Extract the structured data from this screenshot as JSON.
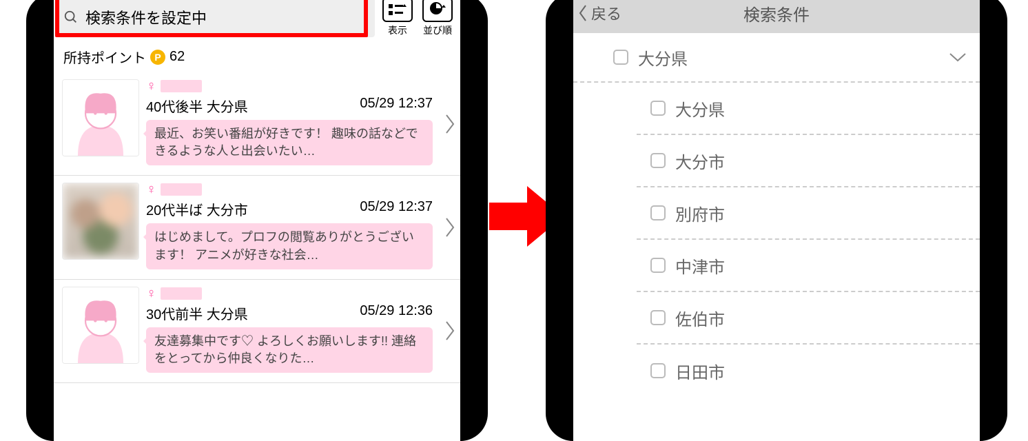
{
  "left": {
    "search_text": "検索条件を設定中",
    "display_btn_label": "表示",
    "sort_btn_label": "並び順",
    "points_label": "所持ポイント",
    "points_value": "62",
    "items": [
      {
        "age_loc": "40代後半 大分県",
        "time": "05/29 12:37",
        "msg": "最近、お笑い番組が好きです！ 趣味の話などできるような人と出会いたい…"
      },
      {
        "age_loc": "20代半ば 大分市",
        "time": "05/29 12:37",
        "msg": "はじめまして。プロフの閲覧ありがとうございます！ アニメが好きな社会…"
      },
      {
        "age_loc": "30代前半 大分県",
        "time": "05/29 12:36",
        "msg": "友達募集中です♡ よろしくお願いします!! 連絡をとってから仲良くなりた…"
      }
    ]
  },
  "right": {
    "back_label": "戻る",
    "title": "検索条件",
    "parent": "大分県",
    "children": [
      "大分県",
      "大分市",
      "別府市",
      "中津市",
      "佐伯市",
      "日田市"
    ]
  }
}
